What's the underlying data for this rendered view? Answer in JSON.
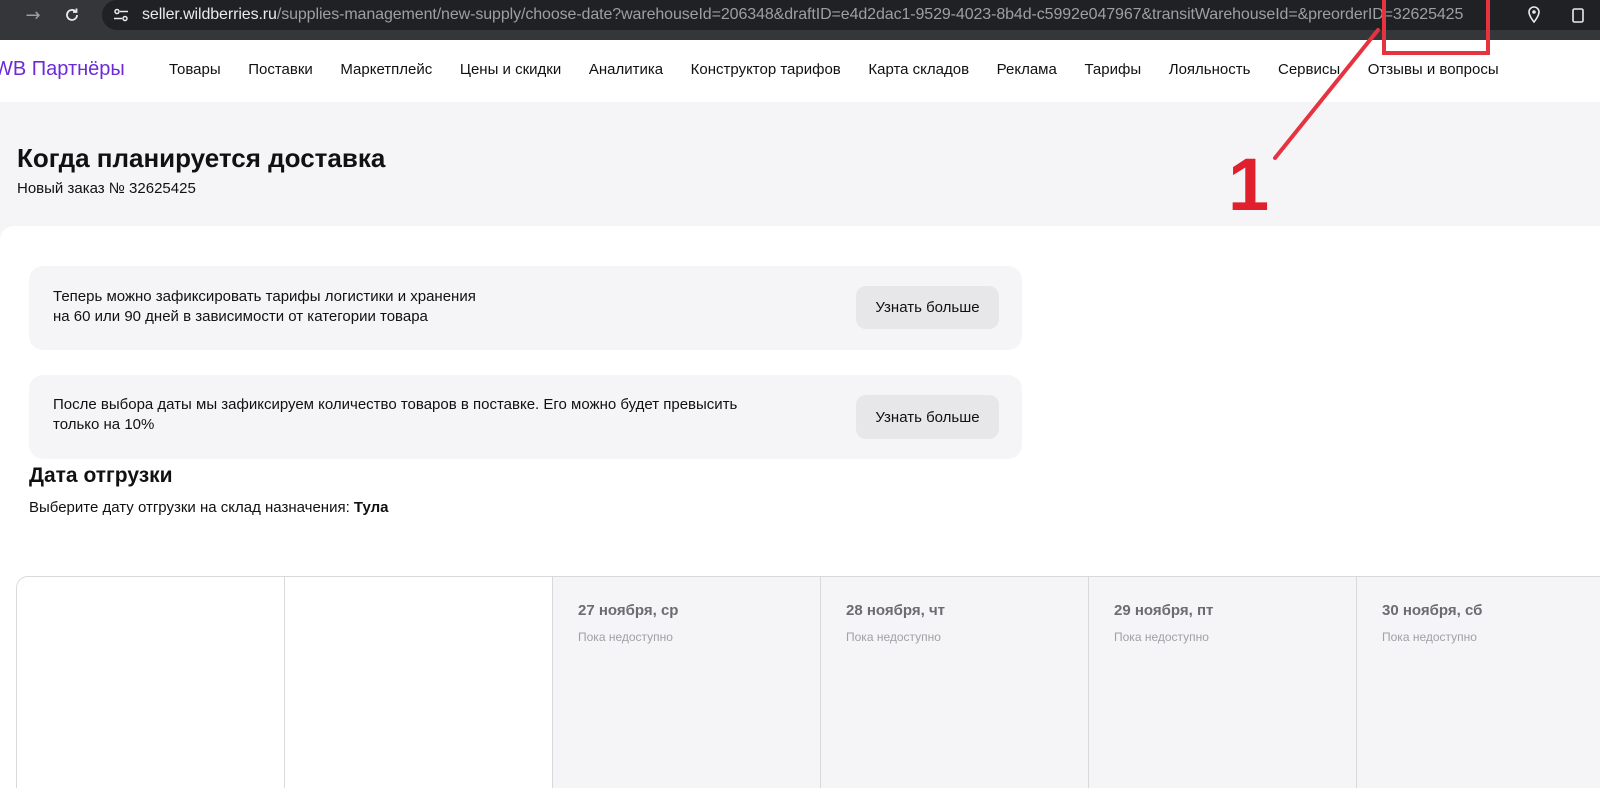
{
  "browser": {
    "url_host": "seller.wildberries.ru",
    "url_path": "/supplies-management/new-supply/choose-date?warehouseId=206348&draftID=e4d2dac1-9529-4023-8b4d-c5992e047967&transitWarehouseId=&preorderID=32625425"
  },
  "topnav": {
    "logo": "WB Партнёры",
    "items": [
      "Товары",
      "Поставки",
      "Маркетплейс",
      "Цены и скидки",
      "Аналитика",
      "Конструктор тарифов",
      "Карта складов",
      "Реклама",
      "Тарифы",
      "Лояльность",
      "Сервисы",
      "Отзывы и вопросы"
    ]
  },
  "header": {
    "title": "Когда планируется доставка",
    "subtitle": "Новый заказ № 32625425"
  },
  "cards": [
    {
      "line1": "Теперь можно зафиксировать тарифы логистики и хранения",
      "line2": "на 60 или 90 дней в зависимости от категории товара",
      "button": "Узнать больше"
    },
    {
      "line1": "После выбора даты мы зафиксируем количество товаров в поставке. Его можно будет превысить",
      "line2": "только на 10%",
      "button": "Узнать больше"
    }
  ],
  "shipping": {
    "title": "Дата отгрузки",
    "desc_prefix": "Выберите дату отгрузки на склад назначения: ",
    "warehouse": "Тула"
  },
  "dates": [
    {
      "label": "27 ноября, ср",
      "status": "Пока недоступно"
    },
    {
      "label": "28 ноября, чт",
      "status": "Пока недоступно"
    },
    {
      "label": "29 ноября, пт",
      "status": "Пока недоступно"
    },
    {
      "label": "30 ноября, сб",
      "status": "Пока недоступно"
    }
  ],
  "annotation": {
    "number": "1",
    "color": "#e53340"
  }
}
